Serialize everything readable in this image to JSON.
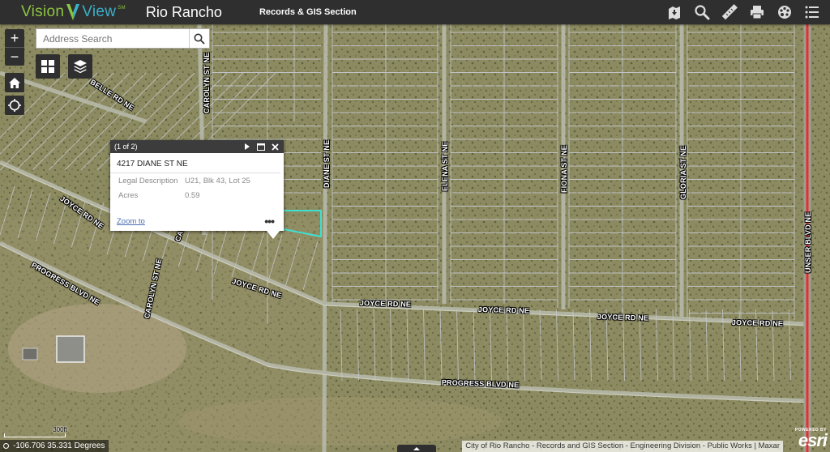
{
  "header": {
    "logo_part1": "Vision",
    "logo_part2": "View",
    "logo_sm": "SM",
    "city": "Rio Rancho",
    "section": "Records & GIS Section",
    "tools": [
      {
        "name": "bookmark-icon"
      },
      {
        "name": "search-icon"
      },
      {
        "name": "measure-icon"
      },
      {
        "name": "print-icon"
      },
      {
        "name": "layers-palette-icon"
      },
      {
        "name": "menu-list-icon"
      }
    ]
  },
  "search": {
    "placeholder": "Address Search"
  },
  "popup": {
    "count": "(1 of 2)",
    "title": "4217 DIANE ST NE",
    "fields": [
      {
        "key": "Legal Description",
        "value": "U21, Blk 43, Lot 25"
      },
      {
        "key": "Acres",
        "value": "0.59"
      }
    ],
    "zoom_to": "Zoom to",
    "more": "•••"
  },
  "road_labels": [
    {
      "text": "CAROLYN ST NE"
    },
    {
      "text": "BELLE RD NE"
    },
    {
      "text": "DIANE ST NE"
    },
    {
      "text": "ELENA ST NE"
    },
    {
      "text": "FIONA ST NE"
    },
    {
      "text": "GLORIA ST NE"
    },
    {
      "text": "UNSER BLVD NE"
    },
    {
      "text": "JOYCE RD NE"
    },
    {
      "text": "CAROLYN"
    },
    {
      "text": "CAROLYN ST NE"
    },
    {
      "text": "JOYCE RD NE"
    },
    {
      "text": "JOYCE RD NE"
    },
    {
      "text": "JOYCE RD NE"
    },
    {
      "text": "JOYCE RD NE"
    },
    {
      "text": "JOYCE RD NE"
    },
    {
      "text": "PROGRESS BLVD NE"
    },
    {
      "text": "PROGRESS BLVD NE"
    }
  ],
  "scale": {
    "label": "300ft"
  },
  "coordinates": "-106.706 35.331 Degrees",
  "attribution": "City of Rio Rancho - Records and GIS Section - Engineering Division - Public Works | Maxar",
  "esri": {
    "powered": "POWERED BY",
    "name": "esri"
  },
  "colors": {
    "header_bg": "#2f2f2f",
    "logo_green": "#8cc63f",
    "logo_blue": "#3ab0c9",
    "parcel_highlight": "#40e0d0",
    "unser_road": "#e53030"
  }
}
